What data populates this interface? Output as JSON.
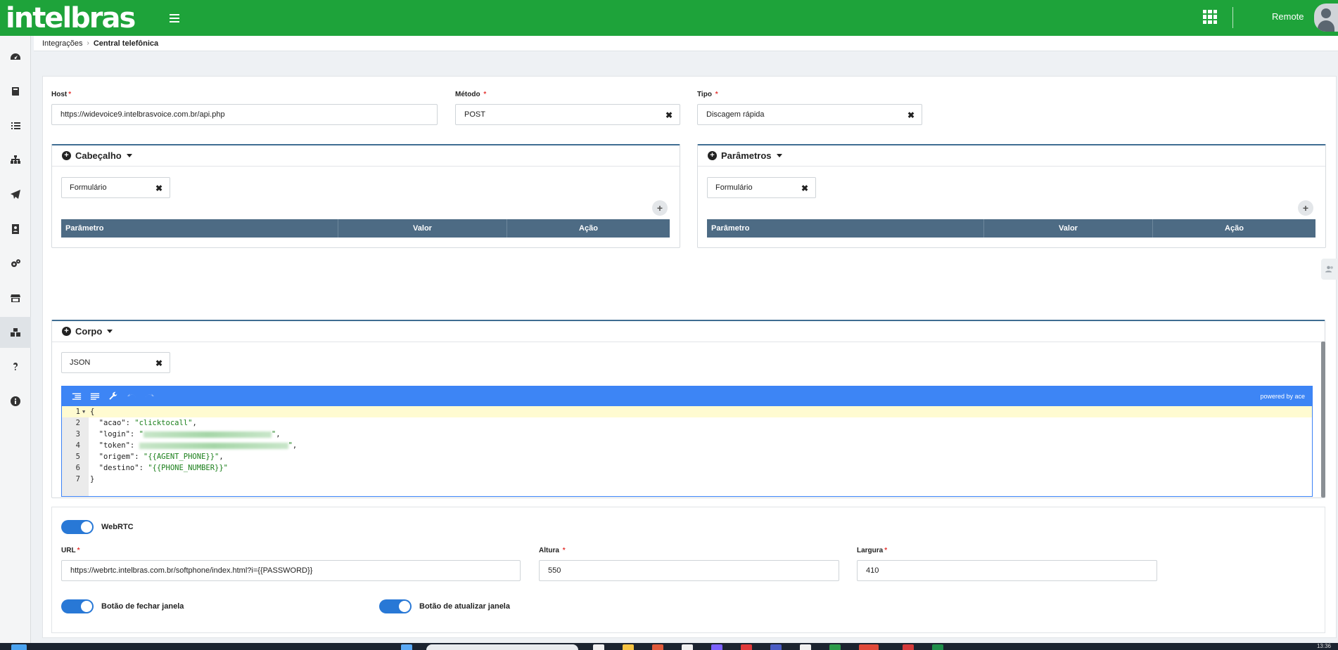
{
  "brand": {
    "logo_text": "intelbras",
    "color": "#1ea33a"
  },
  "topbar": {
    "user_name": "Remote",
    "icons": [
      "menu-icon",
      "apps-grid-icon",
      "user-avatar"
    ]
  },
  "sidebar": {
    "items": [
      {
        "name": "dashboard",
        "icon": "speedometer-icon"
      },
      {
        "name": "book",
        "icon": "book-icon"
      },
      {
        "name": "list",
        "icon": "list-icon"
      },
      {
        "name": "hierarchy",
        "icon": "sitemap-icon"
      },
      {
        "name": "send",
        "icon": "paper-plane-icon"
      },
      {
        "name": "contacts",
        "icon": "address-book-icon"
      },
      {
        "name": "settings",
        "icon": "gears-icon"
      },
      {
        "name": "store",
        "icon": "store-icon"
      },
      {
        "name": "integrations",
        "icon": "cubes-icon",
        "active": true
      },
      {
        "name": "help",
        "icon": "question-icon"
      },
      {
        "name": "info",
        "icon": "info-circle-icon"
      }
    ]
  },
  "breadcrumb": {
    "parent": "Integrações",
    "current": "Central telefônica"
  },
  "form": {
    "host": {
      "label": "Host",
      "value": "https://widevoice9.intelbrasvoice.com.br/api.php"
    },
    "method": {
      "label": "Método",
      "value": "POST"
    },
    "type": {
      "label": "Tipo",
      "value": "Discagem rápida"
    }
  },
  "header_panel": {
    "title": "Cabeçalho",
    "format": "Formulário",
    "columns": [
      "Parâmetro",
      "Valor",
      "Ação"
    ]
  },
  "params_panel": {
    "title": "Parâmetros",
    "format": "Formulário",
    "columns": [
      "Parâmetro",
      "Valor",
      "Ação"
    ]
  },
  "body_panel": {
    "title": "Corpo",
    "format": "JSON",
    "editor_credit": "powered by ace",
    "code": {
      "l1": "{",
      "l2_key": "\"acao\"",
      "l2_val": "\"clicktocall\"",
      "l3_key": "\"login\"",
      "l4_key": "\"token\"",
      "l5_key": "\"origem\"",
      "l5_val": "\"{{AGENT_PHONE}}\"",
      "l6_key": "\"destino\"",
      "l6_val": "\"{{PHONE_NUMBER}}\"",
      "l7": "}"
    },
    "line_numbers": [
      "1",
      "2",
      "3",
      "4",
      "5",
      "6",
      "7"
    ]
  },
  "webrtc": {
    "enabled": true,
    "label": "WebRTC",
    "url": {
      "label": "URL",
      "value": "https://webrtc.intelbras.com.br/softphone/index.html?i={{PASSWORD}}"
    },
    "height": {
      "label": "Altura",
      "value": "550"
    },
    "width": {
      "label": "Largura",
      "value": "410"
    },
    "close_button": {
      "label": "Botão de fechar janela",
      "enabled": true
    },
    "refresh_button": {
      "label": "Botão de atualizar janela",
      "enabled": true
    }
  },
  "taskbar": {
    "clock": "13:36"
  }
}
